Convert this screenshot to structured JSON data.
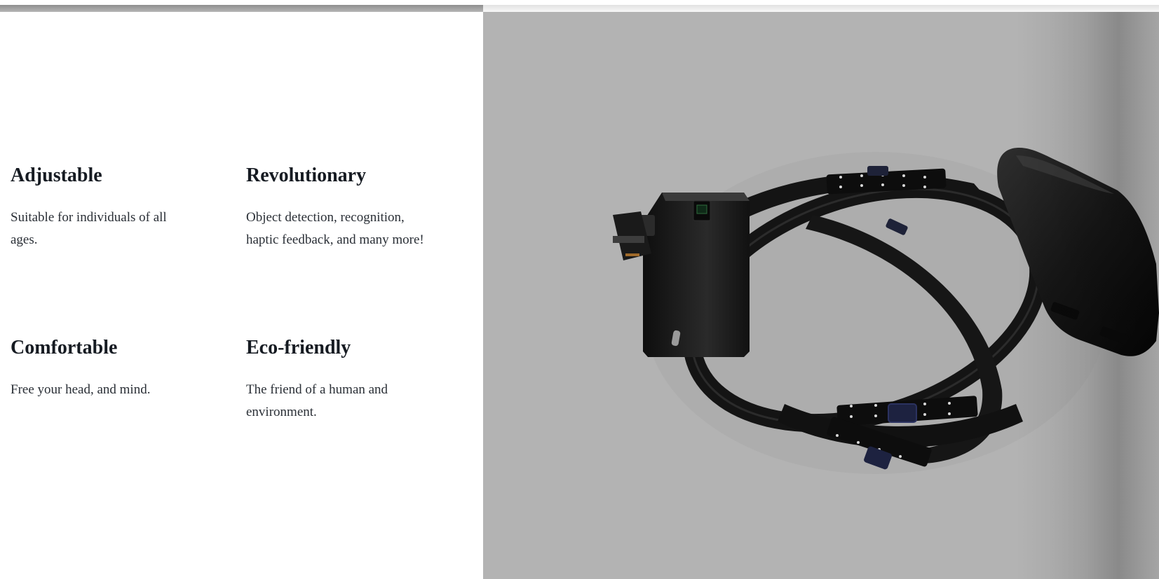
{
  "features": [
    {
      "title": "Adjustable",
      "description": "Suitable for individuals of all ages."
    },
    {
      "title": "Revolutionary",
      "description": "Object detection, recognition, haptic feedback, and many more!"
    },
    {
      "title": "Comfortable",
      "description": "Free your head, and mind."
    },
    {
      "title": "Eco-friendly",
      "description": "The friend of a human and environment."
    }
  ],
  "colors": {
    "heading": "#161b22",
    "body_text": "#2a2f36",
    "render_background": "#b3b3b3",
    "device_body": "#151515"
  }
}
